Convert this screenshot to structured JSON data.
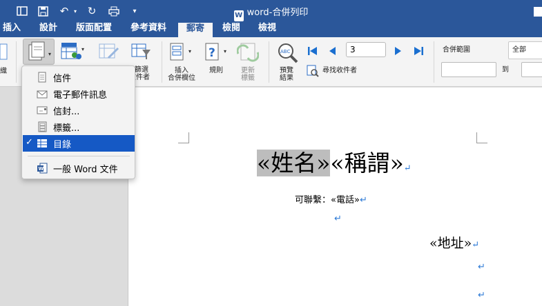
{
  "window": {
    "title": "word-合併列印"
  },
  "tabs": [
    {
      "label": "插入"
    },
    {
      "label": "設計"
    },
    {
      "label": "版面配置"
    },
    {
      "label": "參考資料"
    },
    {
      "label": "郵寄"
    },
    {
      "label": "檢閱"
    },
    {
      "label": "檢視"
    }
  ],
  "active_tab": "郵寄",
  "ribbon": {
    "left_partial_label": "織",
    "filter_label_line1": "篩選",
    "filter_label_line2": "收件者",
    "insert_field_line1": "插入",
    "insert_field_line2": "合併欄位",
    "rules_label": "規則",
    "update_labels_line1": "更新",
    "update_labels_line2": "標籤",
    "preview_line1": "預覽",
    "preview_line2": "結果",
    "find_recipient_label": "尋找收件者",
    "record_number": "3",
    "merge_range_label": "合併範圍",
    "merge_range_value": "全部",
    "to_label": "到"
  },
  "document": {
    "name_field": "«姓名»",
    "title_field": "«稱謂»",
    "contact_label": "可聯繫：",
    "phone_field": "«電話»",
    "address_field": "«地址»",
    "paragraph_mark": "↵"
  },
  "dropdown": {
    "items": [
      {
        "label": "信件",
        "icon": "letter-icon"
      },
      {
        "label": "電子郵件訊息",
        "icon": "email-icon"
      },
      {
        "label": "信封...",
        "icon": "envelope-icon"
      },
      {
        "label": "標籤...",
        "icon": "labels-icon"
      },
      {
        "label": "目錄",
        "icon": "directory-icon",
        "selected": true
      },
      {
        "label": "一般 Word 文件",
        "icon": "word-doc-icon"
      }
    ],
    "check_mark": "✓"
  },
  "colors": {
    "titlebar": "#2b579a",
    "selection": "#1559c5",
    "para_mark": "#2b79d6"
  }
}
